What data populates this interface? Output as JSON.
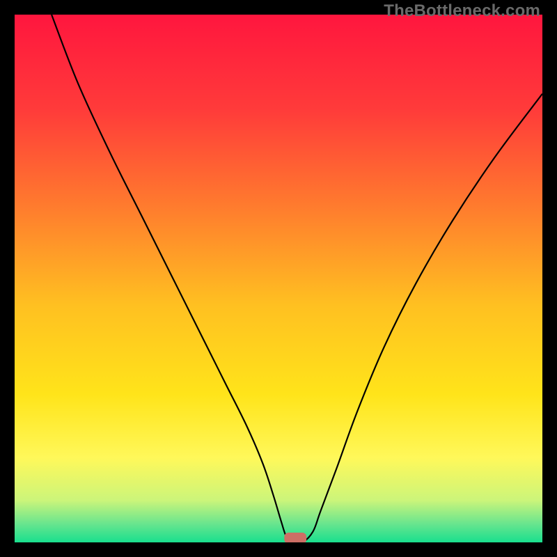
{
  "watermark": "TheBottleneck.com",
  "chart_data": {
    "type": "line",
    "title": "",
    "xlabel": "",
    "ylabel": "",
    "xlim": [
      0,
      100
    ],
    "ylim": [
      0,
      100
    ],
    "background_gradient": {
      "stops": [
        {
          "pos": 0.0,
          "color": "#ff163e"
        },
        {
          "pos": 0.18,
          "color": "#ff3b3a"
        },
        {
          "pos": 0.36,
          "color": "#ff7a2e"
        },
        {
          "pos": 0.55,
          "color": "#ffc021"
        },
        {
          "pos": 0.72,
          "color": "#ffe41a"
        },
        {
          "pos": 0.84,
          "color": "#fff85a"
        },
        {
          "pos": 0.92,
          "color": "#ccf57a"
        },
        {
          "pos": 0.965,
          "color": "#68e58e"
        },
        {
          "pos": 1.0,
          "color": "#19df8e"
        }
      ]
    },
    "series": [
      {
        "name": "bottleneck-curve",
        "color": "#000000",
        "x": [
          7,
          12,
          18,
          24,
          30,
          36,
          40,
          44,
          47,
          49,
          50.5,
          51.5,
          52.5,
          54.5,
          56.5,
          58,
          61,
          65,
          70,
          76,
          83,
          91,
          100
        ],
        "y": [
          100,
          87,
          74,
          62,
          50,
          38,
          30,
          22,
          15,
          9,
          4,
          1,
          0,
          0,
          2,
          6,
          14,
          25,
          37,
          49,
          61,
          73,
          85
        ]
      }
    ],
    "marker": {
      "name": "optimum-marker",
      "shape": "rounded-rect",
      "color": "#cd6f65",
      "x": 53.2,
      "y": 0.8,
      "width": 4.2,
      "height": 2.1
    }
  }
}
